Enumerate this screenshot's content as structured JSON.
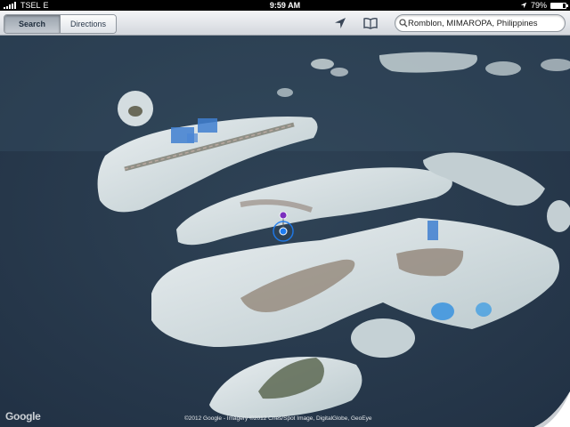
{
  "status_bar": {
    "carrier": "TSEL",
    "network": "E",
    "time": "9:59 AM",
    "battery": "79%",
    "battery_level": 0.79,
    "location_icon": "location-arrow-icon"
  },
  "toolbar": {
    "tabs": [
      {
        "label": "Search",
        "active": true
      },
      {
        "label": "Directions",
        "active": false
      }
    ],
    "location_button_icon": "location-arrow-icon",
    "bookmarks_button_icon": "open-book-icon",
    "search": {
      "value": "Romblon, MIMAROPA, Philippines",
      "icon": "magnifier-icon"
    }
  },
  "map": {
    "view": "satellite",
    "provider_logo": "Google",
    "attribution": "©2012 Google - Imagery ©2012 Cnes/Spot Image, DigitalGlobe, GeoEye",
    "pin_color": "#7b2fbe",
    "current_location_color": "#1d7cf2",
    "sea_color": "#2a3c4f"
  }
}
